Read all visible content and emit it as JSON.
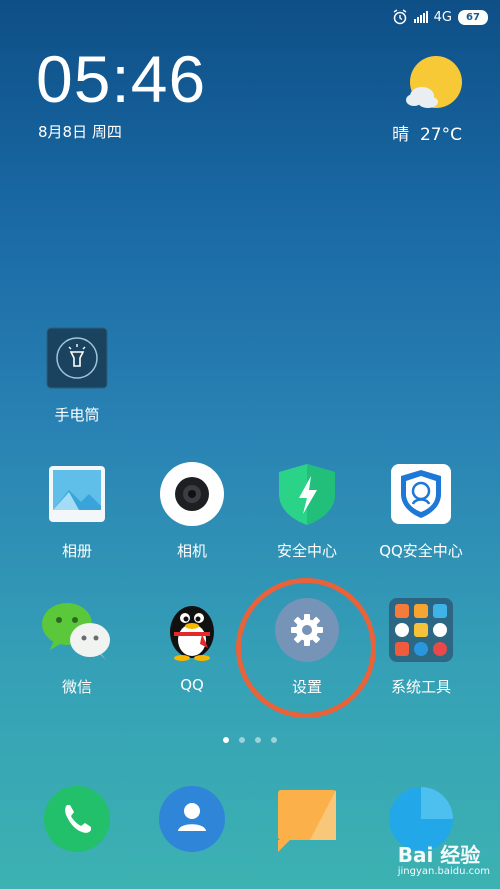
{
  "status": {
    "network": "4G",
    "battery": "67"
  },
  "clock": {
    "time": "05:46",
    "date": "8月8日 周四"
  },
  "weather": {
    "condition": "晴",
    "temperature": "27°C"
  },
  "apps": [
    {
      "label": "手电筒"
    },
    {
      "label": "相册"
    },
    {
      "label": "相机"
    },
    {
      "label": "安全中心"
    },
    {
      "label": "QQ安全中心"
    },
    {
      "label": "微信"
    },
    {
      "label": "QQ"
    },
    {
      "label": "设置"
    },
    {
      "label": "系统工具"
    }
  ],
  "pages": {
    "total": 4,
    "current": 1
  },
  "watermark": {
    "brand": "Bai 经验",
    "url": "jingyan.baidu.com"
  },
  "colors": {
    "highlight": "#e8623a",
    "phone": "#22c06a",
    "contacts": "#2f86d8",
    "messages": "#fbb04a",
    "browser": "#22a8e8"
  }
}
